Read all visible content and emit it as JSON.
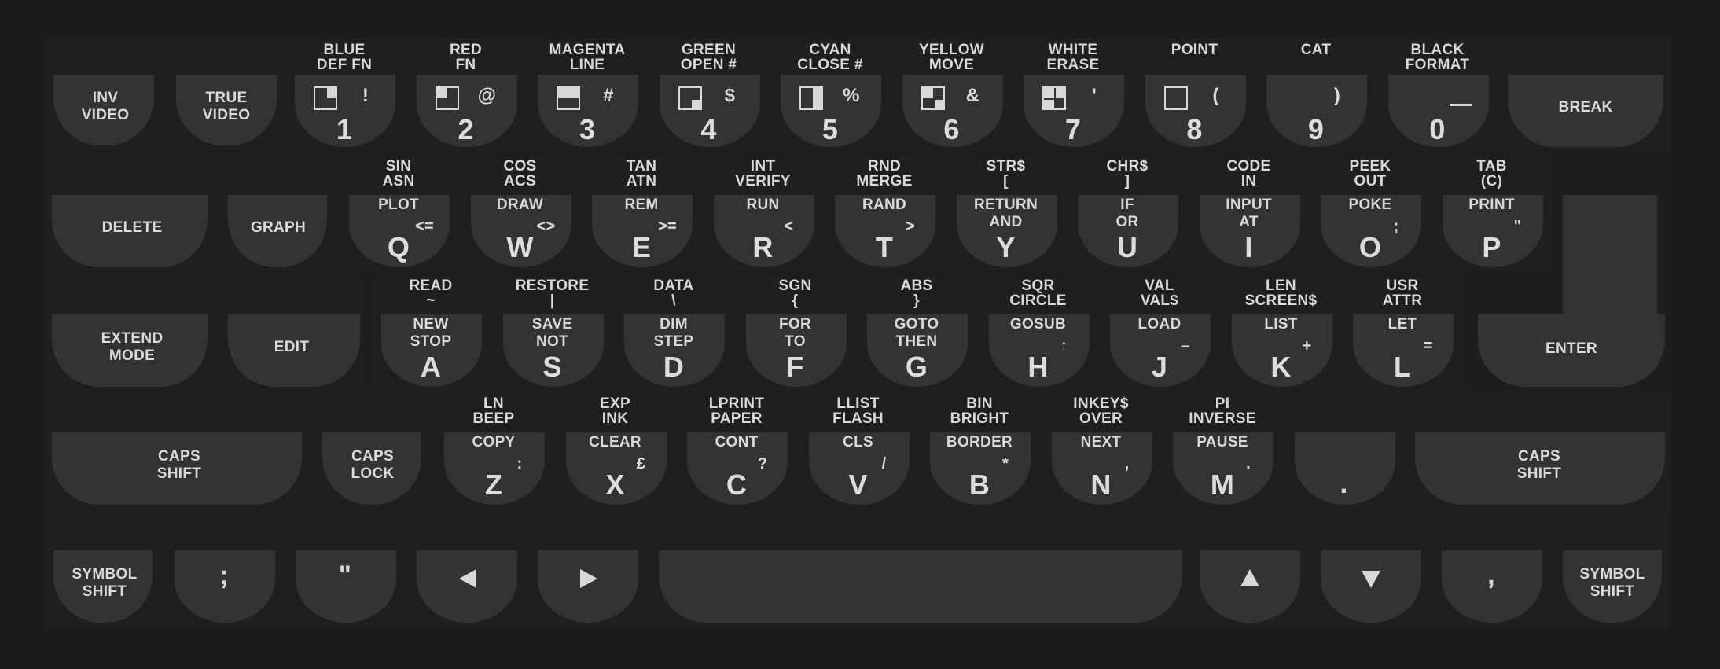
{
  "row1": {
    "inv_video": [
      "INV",
      "VIDEO"
    ],
    "true_video": [
      "TRUE",
      "VIDEO"
    ],
    "keys": [
      {
        "above": [
          "BLUE",
          "DEF FN"
        ],
        "symbol": "!",
        "digit": "1"
      },
      {
        "above": [
          "RED",
          "FN"
        ],
        "symbol": "@",
        "digit": "2"
      },
      {
        "above": [
          "MAGENTA",
          "LINE"
        ],
        "symbol": "#",
        "digit": "3"
      },
      {
        "above": [
          "GREEN",
          "OPEN #"
        ],
        "symbol": "$",
        "digit": "4"
      },
      {
        "above": [
          "CYAN",
          "CLOSE #"
        ],
        "symbol": "%",
        "digit": "5"
      },
      {
        "above": [
          "YELLOW",
          "MOVE"
        ],
        "symbol": "&",
        "digit": "6"
      },
      {
        "above": [
          "WHITE",
          "ERASE"
        ],
        "symbol": "'",
        "digit": "7"
      },
      {
        "above": [
          "POINT",
          ""
        ],
        "symbol": "(",
        "digit": "8"
      },
      {
        "above": [
          "CAT",
          ""
        ],
        "symbol": ")",
        "digit": "9"
      },
      {
        "above": [
          "BLACK",
          "FORMAT"
        ],
        "symbol": "__",
        "digit": "0"
      }
    ],
    "break": "BREAK"
  },
  "row2": {
    "delete": "DELETE",
    "graph": "GRAPH",
    "keys": [
      {
        "above": [
          "SIN",
          "ASN"
        ],
        "keyword": [
          "PLOT",
          ""
        ],
        "symbol": "<=",
        "letter": "Q"
      },
      {
        "above": [
          "COS",
          "ACS"
        ],
        "keyword": [
          "DRAW",
          ""
        ],
        "symbol": "<>",
        "letter": "W"
      },
      {
        "above": [
          "TAN",
          "ATN"
        ],
        "keyword": [
          "REM",
          ""
        ],
        "symbol": ">=",
        "letter": "E"
      },
      {
        "above": [
          "INT",
          "VERIFY"
        ],
        "keyword": [
          "RUN",
          ""
        ],
        "symbol": "<",
        "letter": "R"
      },
      {
        "above": [
          "RND",
          "MERGE"
        ],
        "keyword": [
          "RAND",
          ""
        ],
        "symbol": ">",
        "letter": "T"
      },
      {
        "above": [
          "STR$",
          "["
        ],
        "keyword": [
          "RETURN",
          "AND"
        ],
        "symbol": "",
        "letter": "Y"
      },
      {
        "above": [
          "CHR$",
          "]"
        ],
        "keyword": [
          "IF",
          "OR"
        ],
        "symbol": "",
        "letter": "U"
      },
      {
        "above": [
          "CODE",
          "IN"
        ],
        "keyword": [
          "INPUT",
          "AT"
        ],
        "symbol": "",
        "letter": "I"
      },
      {
        "above": [
          "PEEK",
          "OUT"
        ],
        "keyword": [
          "POKE",
          ""
        ],
        "symbol": ";",
        "letter": "O"
      },
      {
        "above": [
          "TAB",
          "(C)"
        ],
        "keyword": [
          "PRINT",
          ""
        ],
        "symbol": "\"",
        "letter": "P"
      }
    ]
  },
  "row3": {
    "extend_mode": [
      "EXTEND",
      "MODE"
    ],
    "edit": "EDIT",
    "keys": [
      {
        "above": [
          "READ",
          "~"
        ],
        "keyword": [
          "NEW",
          "STOP"
        ],
        "symbol": "",
        "letter": "A"
      },
      {
        "above": [
          "RESTORE",
          "|"
        ],
        "keyword": [
          "SAVE",
          "NOT"
        ],
        "symbol": "",
        "letter": "S"
      },
      {
        "above": [
          "DATA",
          "\\"
        ],
        "keyword": [
          "DIM",
          "STEP"
        ],
        "symbol": "",
        "letter": "D"
      },
      {
        "above": [
          "SGN",
          "{"
        ],
        "keyword": [
          "FOR",
          "TO"
        ],
        "symbol": "",
        "letter": "F"
      },
      {
        "above": [
          "ABS",
          "}"
        ],
        "keyword": [
          "GOTO",
          "THEN"
        ],
        "symbol": "",
        "letter": "G"
      },
      {
        "above": [
          "SQR",
          "CIRCLE"
        ],
        "keyword": [
          "GOSUB",
          ""
        ],
        "symbol": "↑",
        "letter": "H"
      },
      {
        "above": [
          "VAL",
          "VAL$"
        ],
        "keyword": [
          "LOAD",
          ""
        ],
        "symbol": "–",
        "letter": "J"
      },
      {
        "above": [
          "LEN",
          "SCREEN$"
        ],
        "keyword": [
          "LIST",
          ""
        ],
        "symbol": "+",
        "letter": "K"
      },
      {
        "above": [
          "USR",
          "ATTR"
        ],
        "keyword": [
          "LET",
          ""
        ],
        "symbol": "=",
        "letter": "L"
      }
    ],
    "enter": "ENTER"
  },
  "row4": {
    "caps_shift_left": [
      "CAPS",
      "SHIFT"
    ],
    "caps_lock": [
      "CAPS",
      "LOCK"
    ],
    "keys": [
      {
        "above": [
          "LN",
          "BEEP"
        ],
        "keyword": [
          "COPY",
          ""
        ],
        "symbol": ":",
        "letter": "Z"
      },
      {
        "above": [
          "EXP",
          "INK"
        ],
        "keyword": [
          "CLEAR",
          ""
        ],
        "symbol": "£",
        "letter": "X"
      },
      {
        "above": [
          "LPRINT",
          "PAPER"
        ],
        "keyword": [
          "CONT",
          ""
        ],
        "symbol": "?",
        "letter": "C"
      },
      {
        "above": [
          "LLIST",
          "FLASH"
        ],
        "keyword": [
          "CLS",
          ""
        ],
        "symbol": "/",
        "letter": "V"
      },
      {
        "above": [
          "BIN",
          "BRIGHT"
        ],
        "keyword": [
          "BORDER",
          ""
        ],
        "symbol": "*",
        "letter": "B"
      },
      {
        "above": [
          "INKEY$",
          "OVER"
        ],
        "keyword": [
          "NEXT",
          ""
        ],
        "symbol": ",",
        "letter": "N"
      },
      {
        "above": [
          "PI",
          "INVERSE"
        ],
        "keyword": [
          "PAUSE",
          ""
        ],
        "symbol": ".",
        "letter": "M"
      }
    ],
    "dot": ".",
    "caps_shift_right": [
      "CAPS",
      "SHIFT"
    ]
  },
  "row5": {
    "symbol_shift_left": [
      "SYMBOL",
      "SHIFT"
    ],
    "semicolon": ";",
    "quote": "\"",
    "left_arrow_icon": "triangle-left",
    "right_arrow_icon": "triangle-right",
    "space_label": "",
    "up_arrow_icon": "triangle-up",
    "down_arrow_icon": "triangle-down",
    "comma": ",",
    "symbol_shift_right": [
      "SYMBOL",
      "SHIFT"
    ]
  },
  "colors": {
    "background": "#1b1b1b",
    "key": "#333333",
    "text": "#d6d6d6"
  }
}
